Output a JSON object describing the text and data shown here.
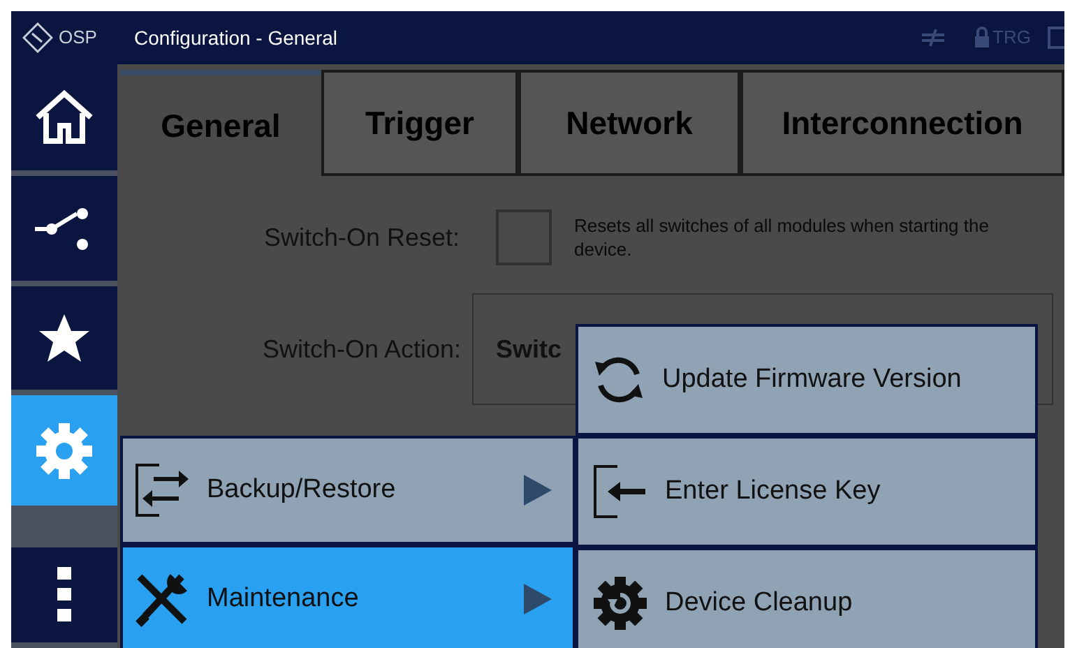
{
  "title_bar": {
    "logo_text": "OSP",
    "title": "Configuration - General",
    "trigger_label": "TRG"
  },
  "sidebar": [
    {
      "kind": "home",
      "selected": false
    },
    {
      "kind": "connector",
      "selected": false
    },
    {
      "kind": "star",
      "selected": false
    },
    {
      "kind": "gear",
      "selected": true
    },
    {
      "kind": "more",
      "selected": false
    }
  ],
  "tabs": [
    {
      "label": "General",
      "selected": true
    },
    {
      "label": "Trigger",
      "selected": false
    },
    {
      "label": "Network",
      "selected": false
    },
    {
      "label": "Interconnection",
      "selected": false
    }
  ],
  "settings": {
    "reset_label": "Switch-On Reset:",
    "reset_checked": false,
    "reset_description": "Resets all switches of all modules when starting the device.",
    "action_label": "Switch-On Action:",
    "action_value": "Switc"
  },
  "menu": [
    {
      "label": "Backup/Restore",
      "kind": "backup",
      "has_submenu": true,
      "selected": false
    },
    {
      "label": "Maintenance",
      "kind": "tools",
      "has_submenu": true,
      "selected": true
    }
  ],
  "submenu": [
    {
      "label": "Update Firmware Version",
      "kind": "refresh",
      "selected": false
    },
    {
      "label": "Enter License Key",
      "kind": "enter",
      "selected": false
    },
    {
      "label": "Device Cleanup",
      "kind": "cleanup",
      "selected": false
    }
  ]
}
